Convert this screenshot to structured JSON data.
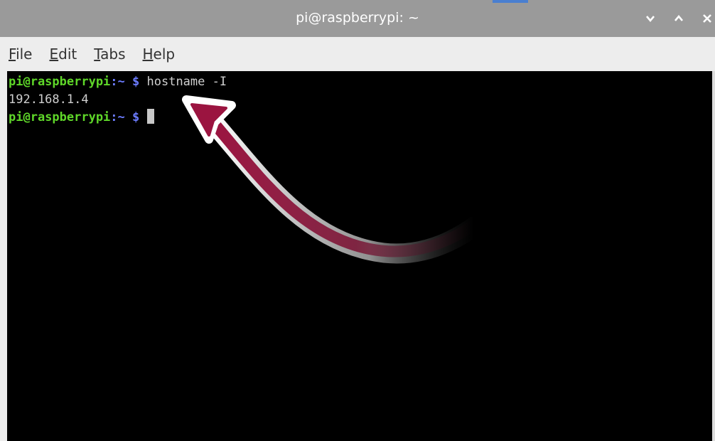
{
  "window": {
    "title": "pi@raspberrypi: ~",
    "controls": {
      "minimize_icon": "chevron-down-icon",
      "maximize_icon": "chevron-up-icon",
      "close_icon": "close-icon"
    }
  },
  "menu": {
    "items": [
      {
        "mnemonic": "F",
        "rest": "ile"
      },
      {
        "mnemonic": "E",
        "rest": "dit"
      },
      {
        "mnemonic": "T",
        "rest": "abs"
      },
      {
        "mnemonic": "H",
        "rest": "elp"
      }
    ]
  },
  "terminal": {
    "lines": [
      {
        "user_host": "pi@raspberrypi",
        "path": ":~",
        "dollar": " $",
        "command": " hostname -I"
      },
      {
        "output": "192.168.1.4"
      },
      {
        "user_host": "pi@raspberrypi",
        "path": ":~",
        "dollar": " $",
        "command": " "
      }
    ]
  },
  "annotation": {
    "arrow_icon": "curved-arrow-icon",
    "arrow_color": "#9b1440"
  },
  "colors": {
    "titlebar": "#9a9a9a",
    "terminal_bg": "#000000",
    "prompt_user": "#5fd729",
    "prompt_path": "#6c7cff",
    "text": "#cfcfcf"
  }
}
